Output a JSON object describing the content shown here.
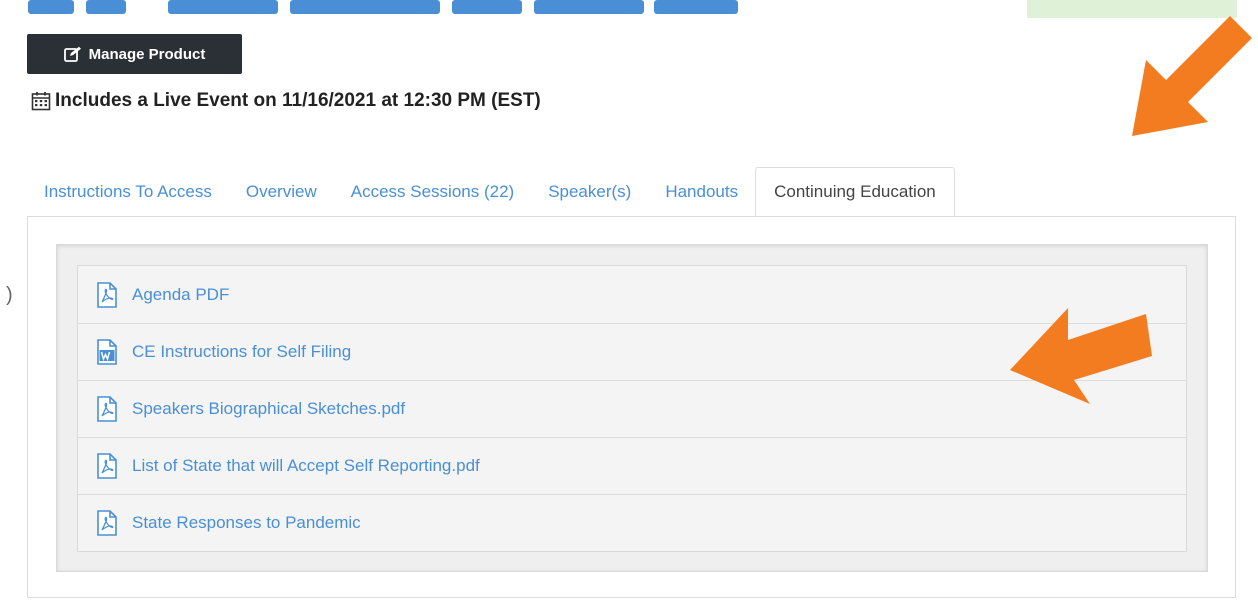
{
  "header": {
    "manage_button_label": "Manage Product",
    "live_event_text": "Includes a Live Event on 11/16/2021 at 12:30 PM (EST)"
  },
  "tabs": [
    {
      "label": "Instructions To Access"
    },
    {
      "label": "Overview"
    },
    {
      "label": "Access Sessions (22)"
    },
    {
      "label": "Speaker(s)"
    },
    {
      "label": "Handouts"
    },
    {
      "label": "Continuing Education",
      "active": true
    }
  ],
  "documents": [
    {
      "label": "Agenda PDF",
      "icon": "pdf-file-icon"
    },
    {
      "label": "CE Instructions for Self Filing",
      "icon": "word-file-icon"
    },
    {
      "label": "Speakers Biographical Sketches.pdf",
      "icon": "pdf-file-icon"
    },
    {
      "label": "List of State that will Accept Self Reporting.pdf",
      "icon": "pdf-file-icon"
    },
    {
      "label": "State Responses to Pandemic",
      "icon": "pdf-file-icon"
    }
  ],
  "colors": {
    "link": "#4a8fd6",
    "button_bg": "#2b2f36",
    "arrow": "#f47c20",
    "green_bar": "#dff1d6"
  }
}
